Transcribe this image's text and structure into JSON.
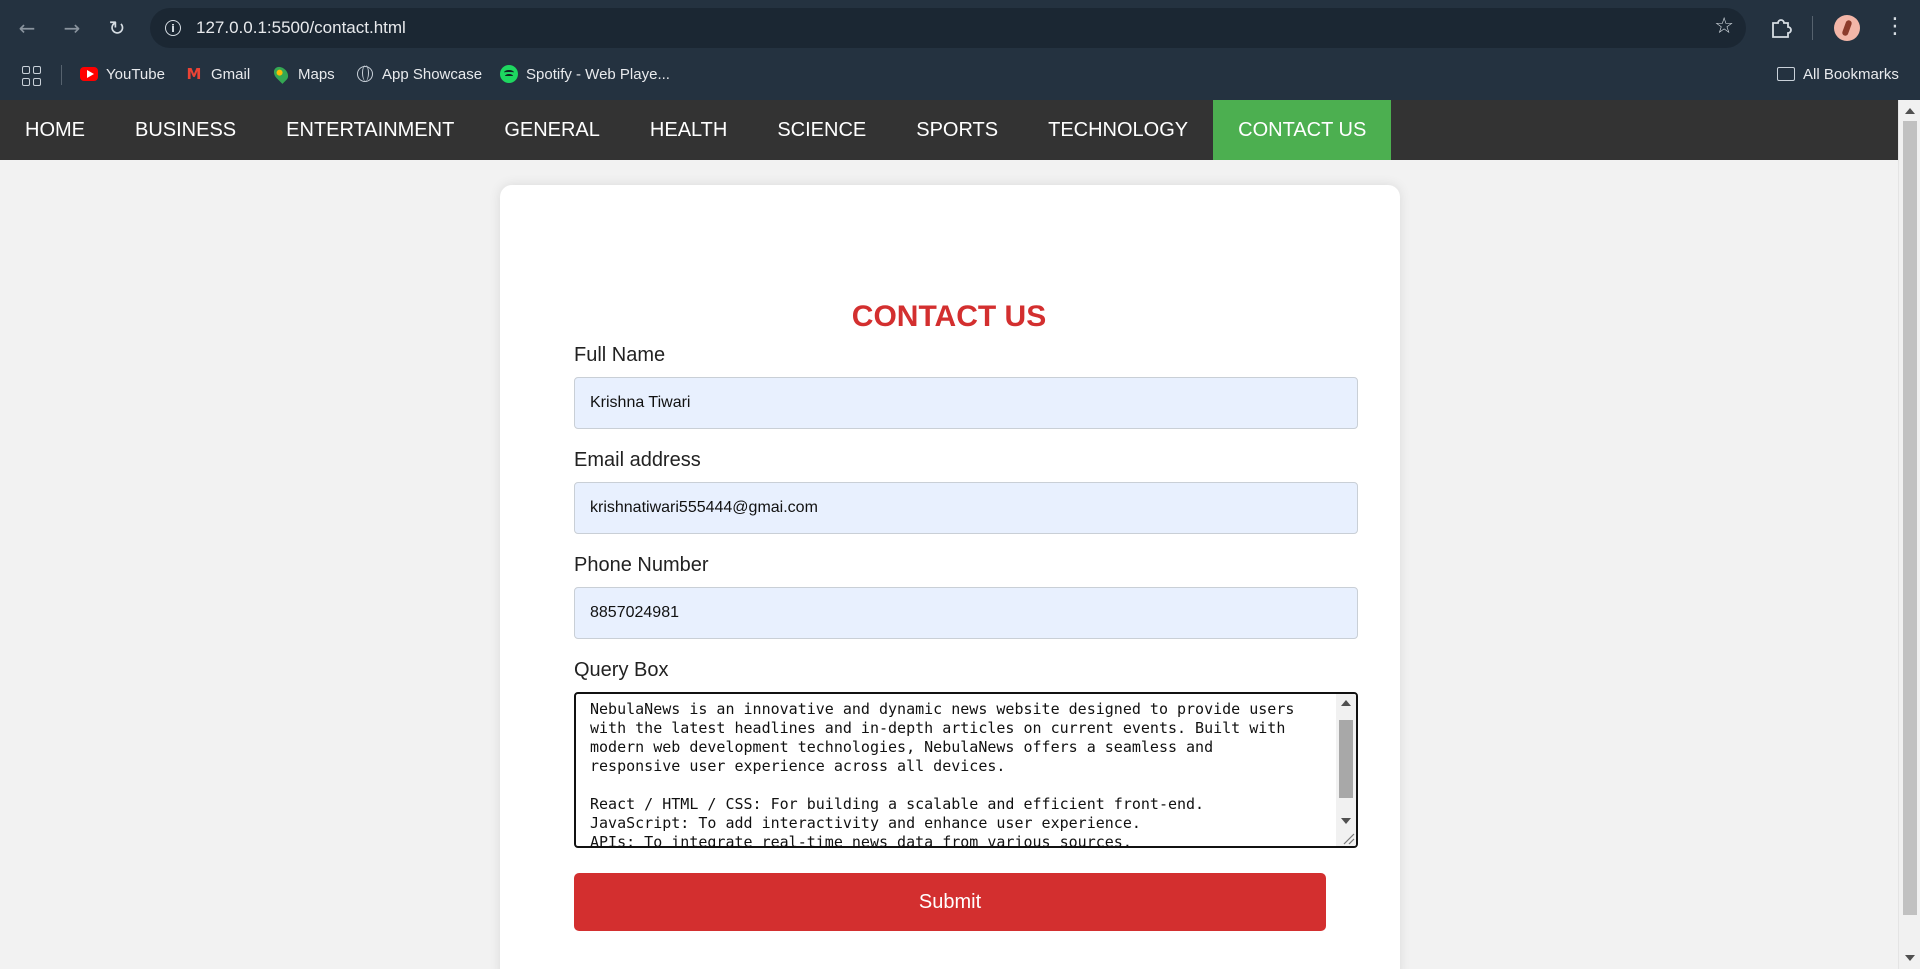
{
  "browser": {
    "url": "127.0.0.1:5500/contact.html",
    "bookmarks": [
      "YouTube",
      "Gmail",
      "Maps",
      "App Showcase",
      "Spotify - Web Playe..."
    ],
    "all_bookmarks": "All Bookmarks"
  },
  "nav": {
    "items": [
      "HOME",
      "BUSINESS",
      "ENTERTAINMENT",
      "GENERAL",
      "HEALTH",
      "SCIENCE",
      "SPORTS",
      "TECHNOLOGY",
      "CONTACT US"
    ],
    "active": "CONTACT US",
    "active_color": "#4caf50",
    "bar_color": "#333333"
  },
  "form": {
    "heading": "CONTACT US",
    "name_label": "Full Name",
    "name_value": "Krishna Tiwari",
    "email_label": "Email address",
    "email_value": "krishnatiwari555444@gmai.com",
    "phone_label": "Phone Number",
    "phone_value": "8857024981",
    "query_label": "Query Box",
    "query_value": "NebulaNews is an innovative and dynamic news website designed to provide users\nwith the latest headlines and in-depth articles on current events. Built with\nmodern web development technologies, NebulaNews offers a seamless and\nresponsive user experience across all devices.\n\nReact / HTML / CSS: For building a scalable and efficient front-end.\nJavaScript: To add interactivity and enhance user experience.\nAPIs: To integrate real-time news data from various sources.",
    "submit_label": "Submit",
    "accent_color": "#d32f2f"
  }
}
